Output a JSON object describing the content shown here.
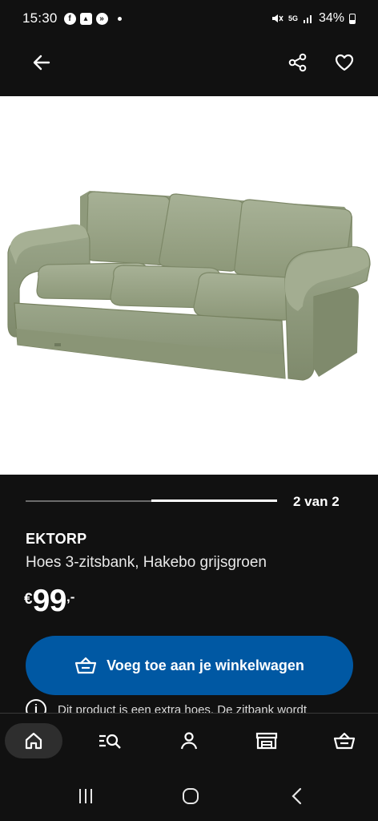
{
  "status_bar": {
    "time": "15:30",
    "battery": "34%",
    "network": "5G"
  },
  "app_bar": {
    "back_icon": "arrow-left-icon",
    "share_icon": "share-icon",
    "favorite_icon": "heart-icon"
  },
  "product": {
    "image_alt": "EKTORP sofa",
    "brand": "EKTORP",
    "description": "Hoes 3-zitsbank, Hakebo grijsgroen",
    "price": {
      "currency": "€",
      "integer": "99",
      "decimal": ",-"
    },
    "sofa_color": "#9aa589"
  },
  "carousel": {
    "counter": "2 van 2",
    "current": 2,
    "total": 2
  },
  "cart_button": {
    "label": "Voeg toe aan je winkelwagen",
    "icon": "basket-icon",
    "color": "#0058a3"
  },
  "info": {
    "text": "Dit product is een extra hoes. De zitbank wordt"
  },
  "bottom_nav": {
    "items": [
      {
        "icon": "home-icon",
        "active": true
      },
      {
        "icon": "search-list-icon",
        "active": false
      },
      {
        "icon": "profile-icon",
        "active": false
      },
      {
        "icon": "store-icon",
        "active": false
      },
      {
        "icon": "basket-icon",
        "active": false
      }
    ]
  },
  "system_nav": {
    "items": [
      "recents-icon",
      "home-circle-icon",
      "back-chevron-icon"
    ]
  }
}
